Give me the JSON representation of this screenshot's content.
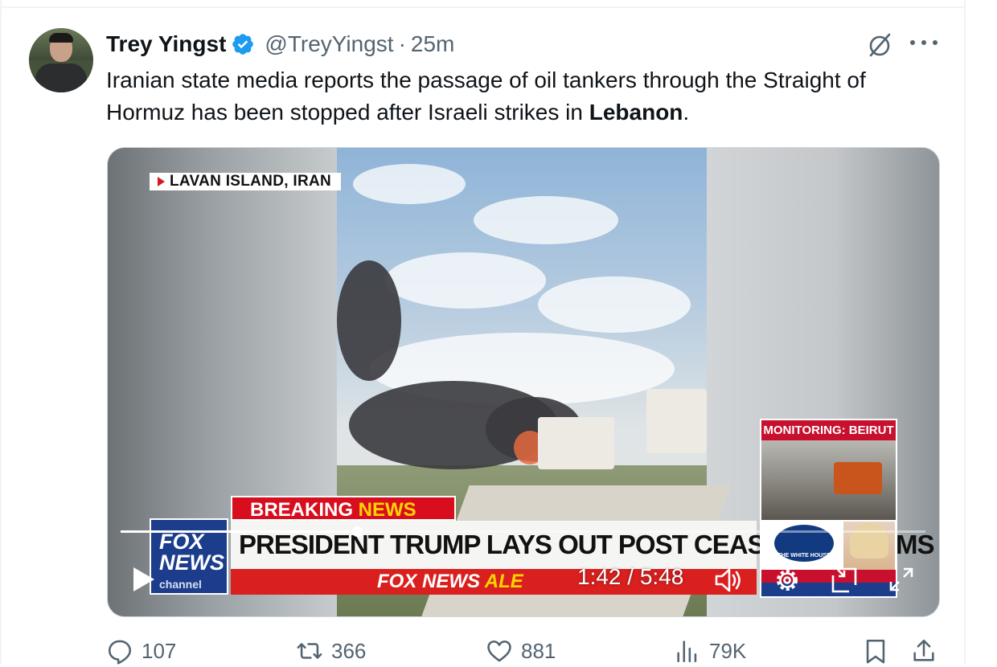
{
  "tweet": {
    "author_name": "Trey Yingst",
    "handle": "@TreyYingst",
    "separator": "·",
    "time_ago": "25m",
    "text_before_bold": "Iranian state media reports the passage of oil tankers through the Straight of Hormuz has been stopped after Israeli strikes in ",
    "text_bold": "Lebanon",
    "text_after_bold": "."
  },
  "video": {
    "location_tag": "LAVAN ISLAND, IRAN",
    "monitoring_label": "MONITORING: BEIRUT",
    "breaking_label_1": "BREAKING ",
    "breaking_label_2": "NEWS",
    "headline": "PRESIDENT TRUMP LAYS OUT POST CEASEFIRE TERMS",
    "fox_logo_line1": "FOX",
    "fox_logo_line2": "NEWS",
    "fox_logo_line3": "channel",
    "alert_text_1": "FOX NEWS ",
    "alert_text_2": "ALE",
    "wh_seal_text": "THE WHITE HOUSE",
    "time_readout": "1:42 / 5:48",
    "progress_fraction": 0.294
  },
  "actions": {
    "replies": "107",
    "reposts": "366",
    "likes": "881",
    "views": "79K"
  },
  "colors": {
    "verified_blue": "#1d9bf0",
    "secondary_text": "#536471",
    "fox_red": "#d80d1e",
    "fox_blue": "#1c3d8c"
  }
}
